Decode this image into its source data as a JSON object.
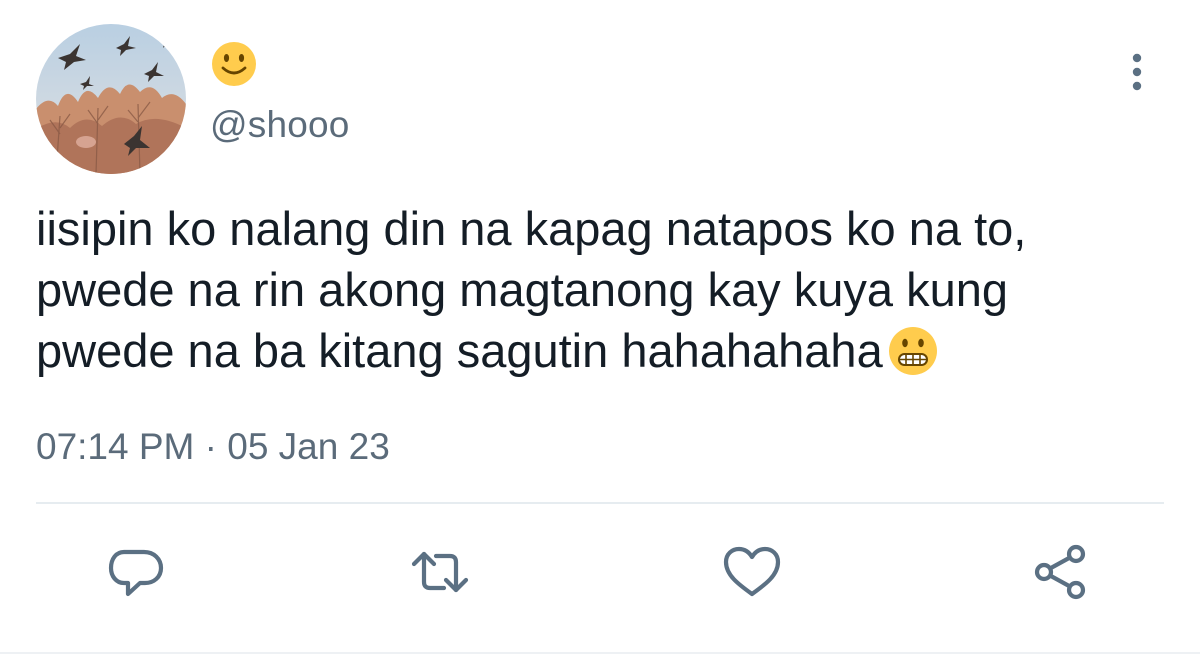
{
  "author": {
    "display_name_icon": "slightly-smiling-face-emoji",
    "handle": "@shooo",
    "avatar": "birds-flying-over-trees-photo"
  },
  "tweet": {
    "lines": [
      "iisipin ko nalang din na kapag natapos ko na to,",
      "pwede na rin akong magtanong kay kuya kung",
      "pwede na ba kitang sagutin hahahahaha"
    ],
    "trailing_emoji": "grimacing-face-emoji",
    "timestamp": "07:14 PM · 05 Jan 23"
  },
  "actions": {
    "reply": "reply-icon",
    "retweet": "retweet-icon",
    "like": "heart-icon",
    "share": "share-icon",
    "more": "more-options-icon"
  },
  "colors": {
    "text": "#141d26",
    "secondary": "#5b6b7a",
    "icon": "#5b7083",
    "emoji_yellow": "#ffcc4d"
  }
}
